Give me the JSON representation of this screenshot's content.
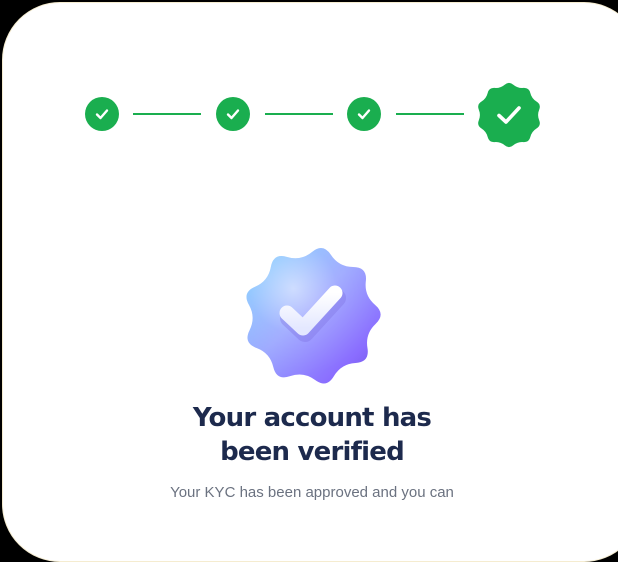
{
  "stepper": {
    "steps": [
      {
        "status": "completed",
        "icon": "check-icon"
      },
      {
        "status": "completed",
        "icon": "check-icon"
      },
      {
        "status": "completed",
        "icon": "check-icon"
      },
      {
        "status": "current-completed",
        "icon": "verified-badge-icon"
      }
    ],
    "color": "#1aae4f"
  },
  "hero": {
    "icon": "verified-badge-icon",
    "colors": [
      "#7fd0ff",
      "#8f8cff",
      "#b08cff"
    ]
  },
  "title": {
    "line1": "Your account has",
    "line2": "been verified"
  },
  "subtitle": "Your KYC has been approved and you can"
}
